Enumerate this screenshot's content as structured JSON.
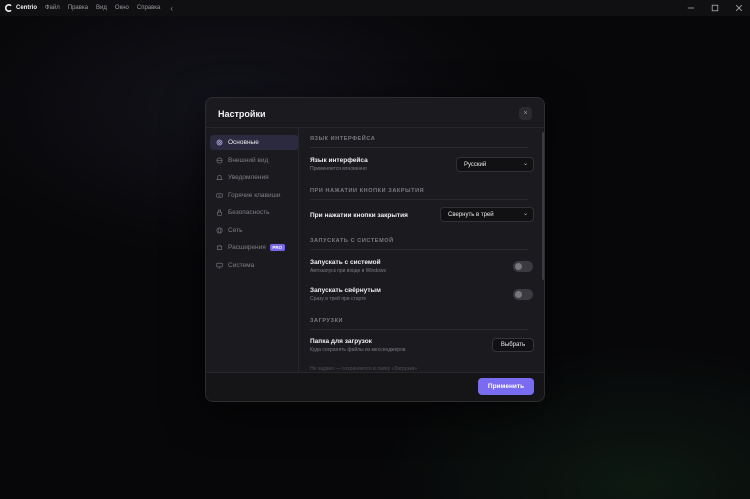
{
  "titlebar": {
    "app_name": "Centrio",
    "menu": [
      "Файл",
      "Правка",
      "Вид",
      "Окно",
      "Справка"
    ],
    "collapse_glyph": "‹"
  },
  "dialog": {
    "title": "Настройки",
    "close_glyph": "×",
    "sidebar": [
      {
        "label": "Основные",
        "icon": "gear-icon",
        "active": true
      },
      {
        "label": "Внешний вид",
        "icon": "palette-icon"
      },
      {
        "label": "Уведомления",
        "icon": "bell-icon"
      },
      {
        "label": "Горячие клавиши",
        "icon": "keyboard-icon"
      },
      {
        "label": "Безопасность",
        "icon": "lock-icon"
      },
      {
        "label": "Сеть",
        "icon": "globe-icon"
      },
      {
        "label": "Расширения",
        "icon": "puzzle-icon",
        "badge": "PRO"
      },
      {
        "label": "Система",
        "icon": "monitor-icon"
      }
    ],
    "sections": {
      "language": {
        "heading": "ЯЗЫК ИНТЕРФЕЙСА",
        "title": "Язык интерфейса",
        "desc": "Применяется мгновенно",
        "value": "Русский"
      },
      "close": {
        "heading": "ПРИ НАЖАТИИ КНОПКИ ЗАКРЫТИЯ",
        "title": "При нажатии кнопки закрытия",
        "value": "Свернуть в трей"
      },
      "startup": {
        "heading": "ЗАПУСКАТЬ С СИСТЕМОЙ",
        "items": [
          {
            "title": "Запускать с системой",
            "desc": "Автозапуск при входе в Windows",
            "on": false
          },
          {
            "title": "Запускать свёрнутым",
            "desc": "Сразу в трей при старте",
            "on": false
          }
        ]
      },
      "downloads": {
        "heading": "ЗАГРУЗКИ",
        "title": "Папка для загрузок",
        "desc": "Куда сохранять файлы из мессенджеров",
        "button": "Выбрать",
        "partial_desc": "Не задано — сохраняются в папку «Загрузки»"
      }
    },
    "apply_label": "Применить"
  },
  "colors": {
    "accent": "#7a6cf0",
    "dialog_bg": "#1b1b1f",
    "app_bg": "#070709"
  }
}
